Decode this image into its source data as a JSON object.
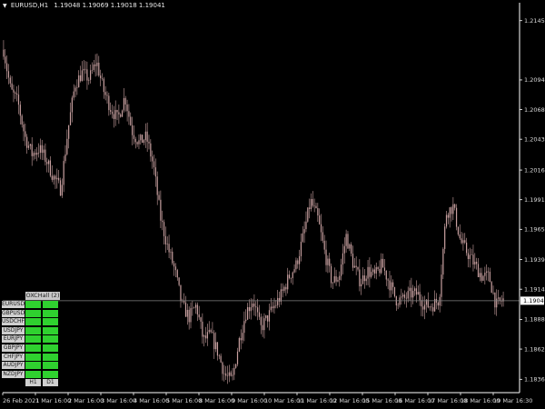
{
  "window": {
    "symbol": "EURUSD,H1",
    "ohlc": "1.19048 1.19069 1.19018 1.19041",
    "menu_icon": "triangle-down-icon"
  },
  "colors": {
    "background": "#000000",
    "candles": "#c8a0a0",
    "price_line": "#808080",
    "axis": "#ffffff",
    "cell_green": "#2fd12f",
    "panel_label": "#cfcfcf"
  },
  "chart_data": {
    "type": "candlestick",
    "symbol": "EURUSD",
    "timeframe": "H1",
    "y_ticks": [
      "1.21450",
      "1.20940",
      "1.20685",
      "1.20430",
      "1.20165",
      "1.19910",
      "1.19655",
      "1.19395",
      "1.19140",
      "1.18880",
      "1.18625",
      "1.18365"
    ],
    "ylim": [
      1.18305,
      1.21565
    ],
    "x_ticks": [
      "26 Feb 2021",
      "1 Mar 16:00",
      "2 Mar 16:00",
      "3 Mar 16:00",
      "4 Mar 16:00",
      "5 Mar 16:00",
      "8 Mar 16:00",
      "9 Mar 16:00",
      "10 Mar 16:00",
      "11 Mar 16:00",
      "12 Mar 16:00",
      "15 Mar 16:00",
      "16 Mar 16:00",
      "17 Mar 16:00",
      "18 Mar 16:00",
      "19 Mar 16:30"
    ],
    "current_price": "1.19041",
    "closes": [
      1.212,
      1.2085,
      1.2075,
      1.2045,
      1.203,
      1.2035,
      1.2025,
      1.201,
      1.2,
      1.205,
      1.209,
      1.21,
      1.2095,
      1.211,
      1.2085,
      1.207,
      1.206,
      1.208,
      1.205,
      1.204,
      1.2045,
      1.202,
      1.1975,
      1.195,
      1.193,
      1.19,
      1.189,
      1.19,
      1.187,
      1.1875,
      1.186,
      1.184,
      1.1835,
      1.187,
      1.1895,
      1.1905,
      1.188,
      1.189,
      1.19,
      1.191,
      1.1925,
      1.1935,
      1.196,
      1.199,
      1.1975,
      1.1945,
      1.192,
      1.1925,
      1.196,
      1.1935,
      1.192,
      1.193,
      1.1925,
      1.1935,
      1.192,
      1.1905,
      1.1905,
      1.191,
      1.191,
      1.19,
      1.19,
      1.1905,
      1.198,
      1.1985,
      1.1955,
      1.1945,
      1.1935,
      1.1925,
      1.1925,
      1.19,
      1.1905
    ]
  },
  "panel": {
    "header": "OXCHall (2)",
    "pairs": [
      "EURUSD",
      "GBPUSD",
      "USDCHF",
      "USDJPY",
      "EURJPY",
      "GBPJPY",
      "CHFJPY",
      "AUDJPY",
      "NZDJPY"
    ],
    "footer": [
      "H1",
      "D1"
    ]
  }
}
